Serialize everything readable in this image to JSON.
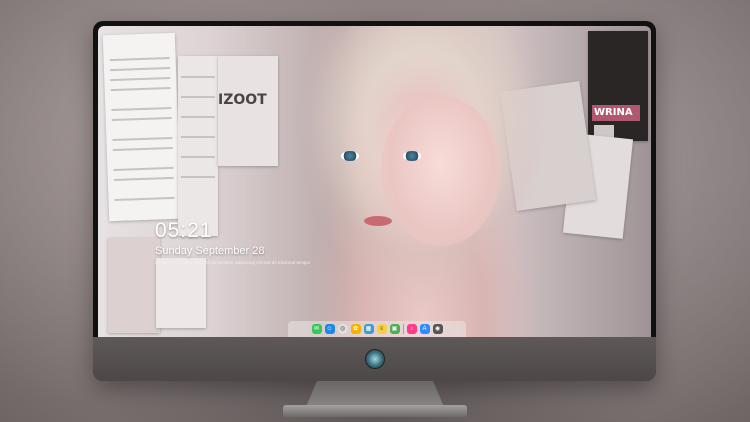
{
  "lock_screen": {
    "time": "05:21",
    "date": "Sunday September  28",
    "subtitle": "Lorem ipsum dolor sit amet consectetur adipiscing elit sed do eiusmod tempor"
  },
  "wallpaper": {
    "poster_text_1": "IZOOT",
    "poster_text_2": "WRINA"
  },
  "dock": {
    "items": [
      {
        "name": "messages-icon",
        "color": "#34c759"
      },
      {
        "name": "finder-icon",
        "color": "#1e88e5"
      },
      {
        "name": "safari-icon",
        "color": "#e0e0e0"
      },
      {
        "name": "photos-icon",
        "color": "#f4b400"
      },
      {
        "name": "clapper-icon",
        "color": "#3aa0c8"
      },
      {
        "name": "notes-icon",
        "color": "#f7d046"
      },
      {
        "name": "preview-icon",
        "color": "#4caf50"
      },
      {
        "name": "music-icon",
        "color": "#ff3b8a"
      },
      {
        "name": "appstore-icon",
        "color": "#2f8cff"
      },
      {
        "name": "camera-icon",
        "color": "#555555"
      }
    ]
  }
}
